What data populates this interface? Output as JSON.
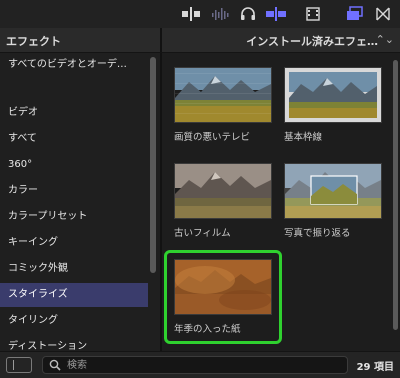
{
  "toolbar": {
    "icons": [
      "audio-split-icon",
      "waveform-icon",
      "headphones-icon",
      "clip-skimming-icon",
      "filmstrip-icon",
      "browser-toggle-icon",
      "transitions-icon"
    ],
    "accent_color": "#6f6fff"
  },
  "header": {
    "left_title": "エフェクト",
    "right_title": "インストール済みエフェ…",
    "chevron": "⌃⌄"
  },
  "sidebar": {
    "items": [
      {
        "label": "すべてのビデオとオーデ…"
      },
      {
        "label": ""
      },
      {
        "label": "ビデオ"
      },
      {
        "label": "すべて"
      },
      {
        "label": "360°"
      },
      {
        "label": "カラー"
      },
      {
        "label": "カラープリセット"
      },
      {
        "label": "キーイング"
      },
      {
        "label": "コミック外観"
      },
      {
        "label": "スタイライズ"
      },
      {
        "label": "タイリング"
      },
      {
        "label": "ディストーション"
      }
    ],
    "selected_label": "スタイライズ",
    "selected_color": "#3a3c6c"
  },
  "effects": {
    "tiles": [
      {
        "label": "画質の悪いテレビ"
      },
      {
        "label": "基本枠線"
      },
      {
        "label": "古いフィルム"
      },
      {
        "label": "写真で振り返る"
      },
      {
        "label": "年季の入った紙"
      }
    ],
    "selected_label": "年季の入った紙",
    "highlight_color": "#2fd12f"
  },
  "bottom": {
    "search_placeholder": "検索",
    "item_count": "29 項目"
  }
}
